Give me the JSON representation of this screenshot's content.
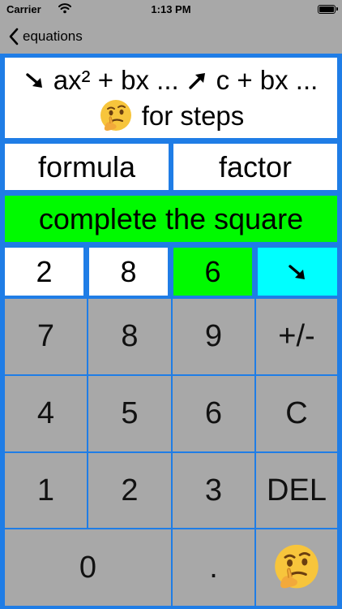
{
  "status_bar": {
    "carrier": "Carrier",
    "time": "1:13 PM"
  },
  "nav": {
    "back_label": "equations"
  },
  "instructions": {
    "form1": "ax² + bx ...",
    "form2": "c + bx ...",
    "steps_text": "for steps"
  },
  "methods": {
    "formula": "formula",
    "factor": "factor",
    "complete": "complete the square"
  },
  "coefficients": {
    "a": "2",
    "b": "8",
    "c": "6"
  },
  "keypad": {
    "k7": "7",
    "k8": "8",
    "k9": "9",
    "sign": "+/-",
    "k4": "4",
    "k5": "5",
    "k6": "6",
    "clear": "C",
    "k1": "1",
    "k2": "2",
    "k3": "3",
    "del": "DEL",
    "k0": "0",
    "dot": "."
  },
  "colors": {
    "background": "#1f7de6",
    "bar": "#a8a8a8",
    "selected": "#00fa00",
    "action": "#00ffff"
  },
  "icons": {
    "down_right_arrow": "arrow-down-right-icon",
    "up_right_arrow": "arrow-up-right-icon",
    "thinking_face": "thinking-face-icon"
  }
}
